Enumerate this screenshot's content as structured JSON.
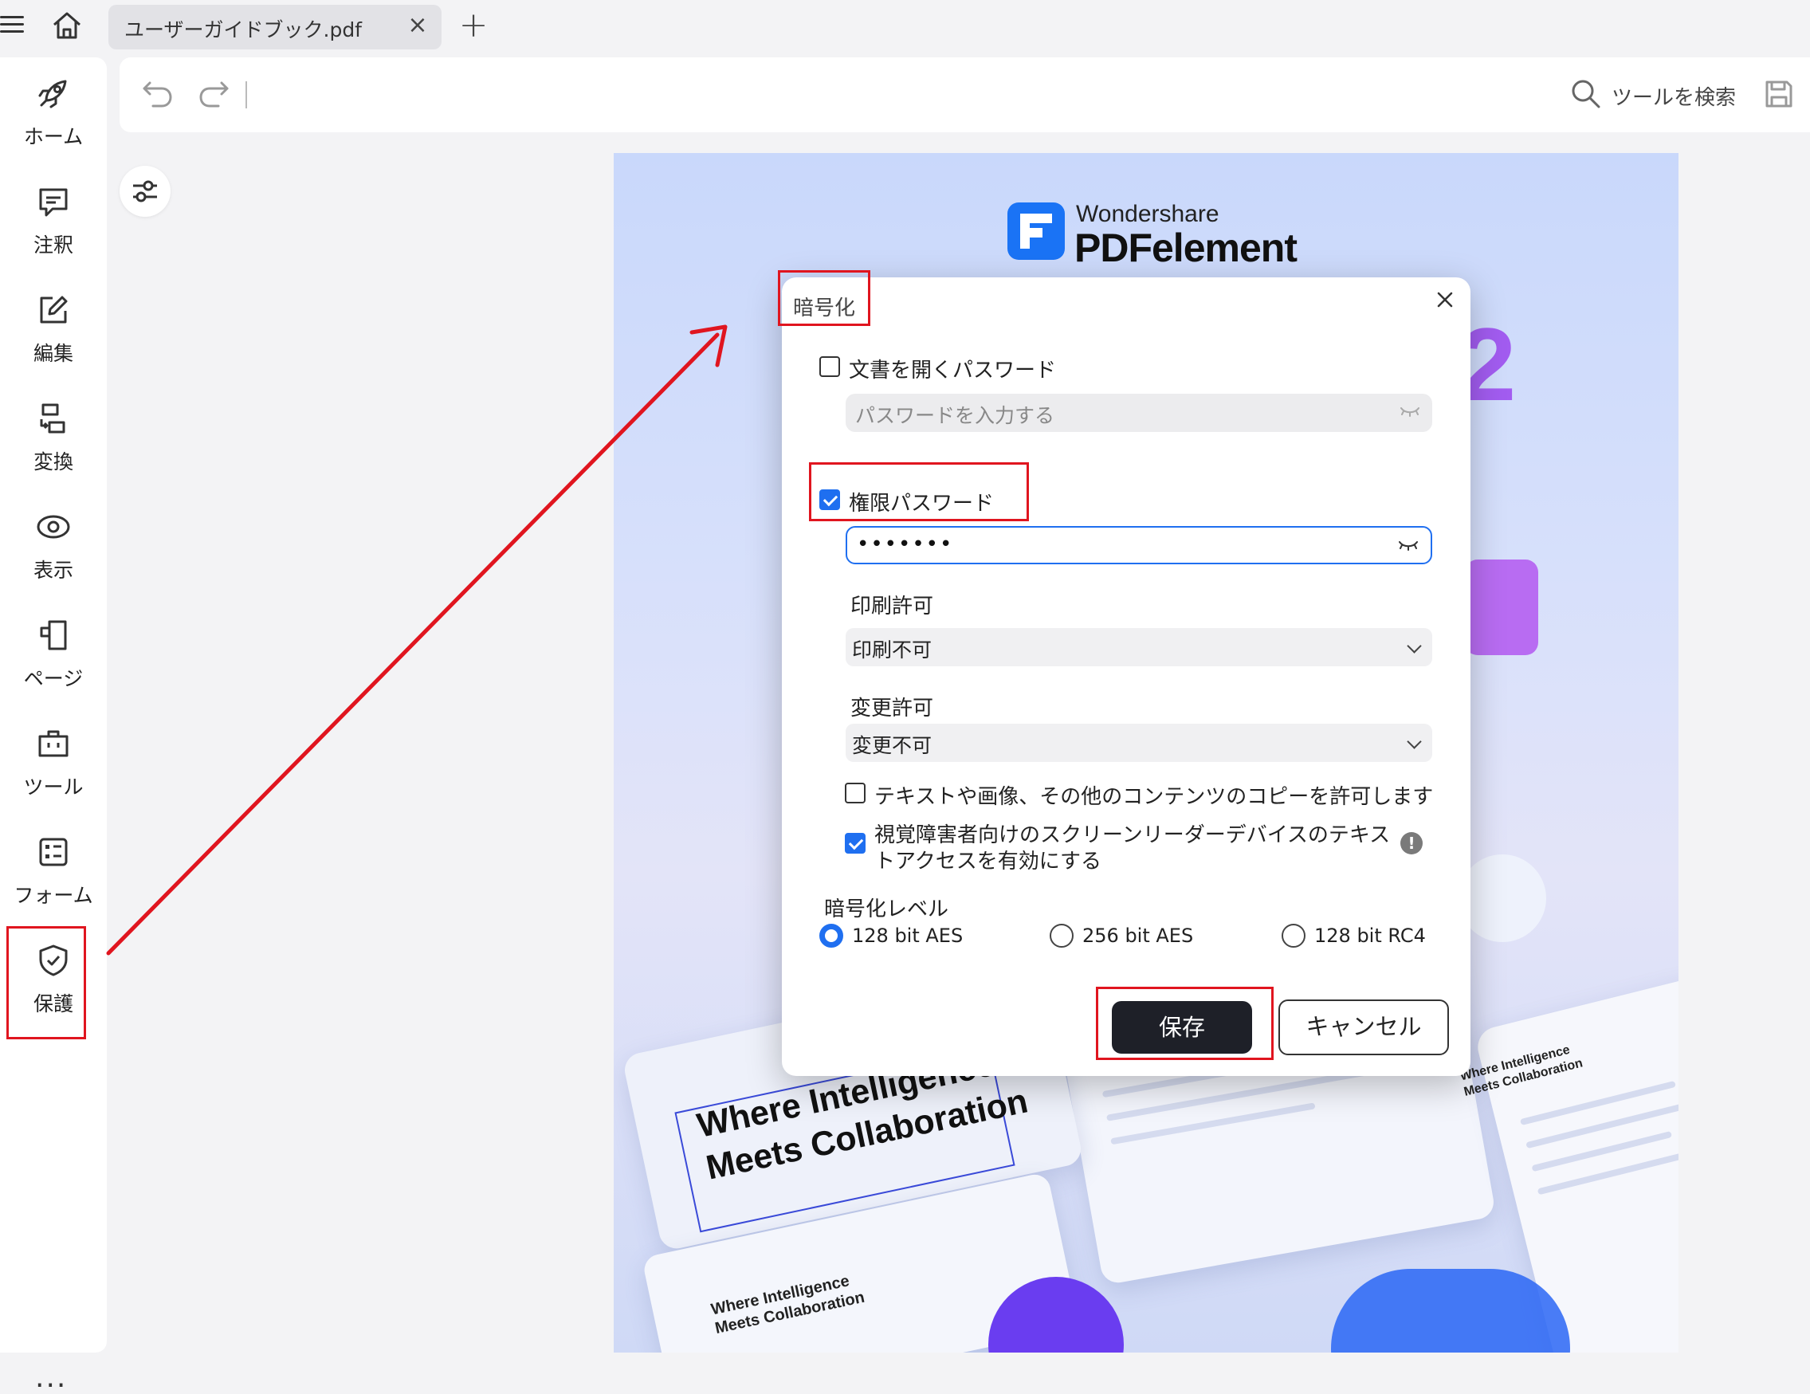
{
  "tab": {
    "title": "ユーザーガイドブック.pdf"
  },
  "sidebar": {
    "items": [
      {
        "label": "ホーム",
        "icon": "rocket-icon"
      },
      {
        "label": "注釈",
        "icon": "comment-icon"
      },
      {
        "label": "編集",
        "icon": "edit-icon"
      },
      {
        "label": "変換",
        "icon": "convert-icon"
      },
      {
        "label": "表示",
        "icon": "view-icon"
      },
      {
        "label": "ページ",
        "icon": "page-icon"
      },
      {
        "label": "ツール",
        "icon": "toolbox-icon"
      },
      {
        "label": "フォーム",
        "icon": "form-icon"
      },
      {
        "label": "保護",
        "icon": "shield-icon"
      }
    ],
    "more": "..."
  },
  "toolbar": {
    "search_label": "ツールを検索"
  },
  "document": {
    "brand_top": "Wondershare",
    "brand_main": "PDFelement",
    "big_digit": "2",
    "hero_line1": "Where Intelligence",
    "hero_line2": "Meets Collaboration",
    "small_line1": "Where Intelligence",
    "small_line2": "Meets Collaboration",
    "right_line1": "Where Intelligence",
    "right_line2": "Meets Collaboration"
  },
  "dialog": {
    "title": "暗号化",
    "open_password": {
      "label": "文書を開くパスワード",
      "checked": false,
      "placeholder": "パスワードを入力する"
    },
    "permission_password": {
      "label": "権限パスワード",
      "checked": true,
      "value": "•••••••"
    },
    "print": {
      "label": "印刷許可",
      "value": "印刷不可"
    },
    "change": {
      "label": "変更許可",
      "value": "変更不可"
    },
    "copy_option": {
      "label": "テキストや画像、その他のコンテンツのコピーを許可します",
      "checked": false
    },
    "reader_option": {
      "line1": "視覚障害者向けのスクリーンリーダーデバイスのテキス",
      "line2": "トアクセスを有効にする",
      "checked": true,
      "info": "!"
    },
    "encryption_level": {
      "label": "暗号化レベル",
      "options": [
        "128 bit AES",
        "256 bit AES",
        "128 bit RC4"
      ],
      "selected": "128 bit AES"
    },
    "save_label": "保存",
    "cancel_label": "キャンセル"
  },
  "colors": {
    "accent": "#1f6ff0",
    "annotation": "#e0151f",
    "dark_button": "#1e2028"
  }
}
